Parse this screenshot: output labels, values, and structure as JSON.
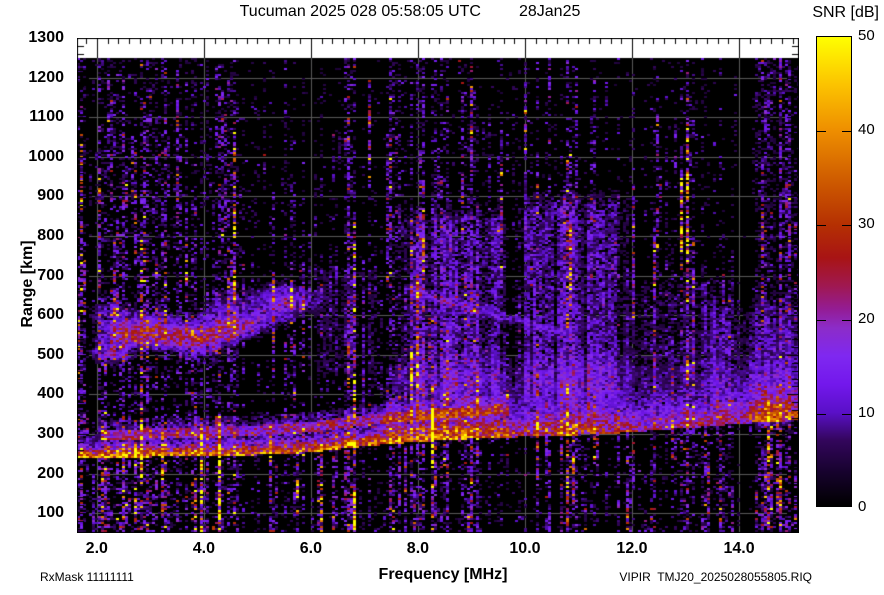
{
  "header": {
    "title": "Tucuman 2025 028 05:58:05 UTC",
    "date": "28Jan25",
    "value_label": "SNR [dB]"
  },
  "footer": {
    "rx_mask": "RxMask 11111111",
    "file_label": "VIPIR  TMJ20_2025028055805.RIQ"
  },
  "chart_data": {
    "type": "heatmap",
    "title": "Tucuman 2025 028 05:58:05 UTC",
    "date_label": "28Jan25",
    "xlabel": "Frequency [MHz]",
    "ylabel": "Range [km]",
    "value_label": "SNR [dB]",
    "xlim": [
      1.63,
      15.12
    ],
    "ylim": [
      50,
      1300
    ],
    "data_top_km": 1250,
    "x_ticks": [
      2,
      4,
      6,
      8,
      10,
      12,
      14
    ],
    "x_tick_labels": [
      "2.0",
      "4.0",
      "6.0",
      "8.0",
      "10.0",
      "12.0",
      "14.0"
    ],
    "x_minor_step": 0.2,
    "y_ticks": [
      100,
      200,
      300,
      400,
      500,
      600,
      700,
      800,
      900,
      1000,
      1100,
      1200,
      1300
    ],
    "y_minor_step": 20,
    "grid": true,
    "grid_color": "#5a5a5a",
    "colorbar": {
      "label": "SNR [dB]",
      "min": 0,
      "max": 50,
      "ticks": [
        0,
        10,
        20,
        30,
        40,
        50
      ],
      "stops": [
        [
          0.0,
          "#000000"
        ],
        [
          0.07,
          "#16022c"
        ],
        [
          0.14,
          "#33065c"
        ],
        [
          0.2,
          "#5a10c8"
        ],
        [
          0.26,
          "#7318ec"
        ],
        [
          0.32,
          "#7f28f0"
        ],
        [
          0.38,
          "#8c2cc8"
        ],
        [
          0.42,
          "#941c94"
        ],
        [
          0.47,
          "#a01850"
        ],
        [
          0.53,
          "#a81414"
        ],
        [
          0.6,
          "#b53002"
        ],
        [
          0.7,
          "#d05e00"
        ],
        [
          0.8,
          "#ee8e00"
        ],
        [
          0.9,
          "#fcc400"
        ],
        [
          1.0,
          "#ffff00"
        ]
      ]
    },
    "noise": {
      "seed": 1337,
      "cell": [
        3,
        2
      ],
      "base_mean_db": 1.7,
      "threshold_db": 4.3,
      "region_mults": [
        [
          1.63,
          1.82,
          3.4
        ],
        [
          1.82,
          4.6,
          1.28
        ],
        [
          4.6,
          6.6,
          0.82
        ],
        [
          6.6,
          9.6,
          0.92
        ],
        [
          9.6,
          12.2,
          0.72
        ],
        [
          12.2,
          15.12,
          0.85
        ]
      ],
      "low_range_boost": {
        "below_km": 350,
        "mult": 1.45
      },
      "rfi_lines": [
        [
          2.1,
          1.6,
          0.06
        ],
        [
          2.5,
          1.2,
          0.05
        ],
        [
          2.9,
          1.4,
          0.06
        ],
        [
          3.25,
          1.2,
          0.05
        ],
        [
          4.25,
          1.1,
          0.05
        ],
        [
          4.6,
          1.4,
          0.06
        ],
        [
          6.2,
          1.3,
          0.05
        ],
        [
          6.78,
          2.6,
          0.05
        ],
        [
          7.5,
          1.1,
          0.05
        ],
        [
          8.1,
          1.3,
          0.06
        ],
        [
          8.55,
          1.5,
          0.07
        ],
        [
          9.0,
          1.4,
          0.06
        ],
        [
          9.55,
          1.2,
          0.05
        ],
        [
          10.4,
          1.3,
          0.05
        ],
        [
          10.9,
          1.7,
          0.06
        ],
        [
          11.3,
          1.3,
          0.05
        ],
        [
          12.4,
          1.1,
          0.05
        ],
        [
          13.1,
          1.4,
          0.05
        ],
        [
          14.35,
          1.5,
          0.06
        ],
        [
          14.9,
          1.7,
          0.08
        ]
      ],
      "dark_bands": [
        [
          5.0,
          5.55,
          0.7
        ],
        [
          9.82,
          10.08,
          0.8
        ],
        [
          13.92,
          14.22,
          0.4
        ]
      ]
    },
    "features": {
      "main_trace": {
        "bottom_edge": [
          [
            1.63,
            243
          ],
          [
            3,
            247
          ],
          [
            5,
            252
          ],
          [
            6,
            258
          ],
          [
            6.6,
            268
          ],
          [
            7.5,
            280
          ],
          [
            8.5,
            290
          ],
          [
            9.5,
            296
          ],
          [
            10.5,
            300
          ],
          [
            11.5,
            305
          ],
          [
            12.5,
            315
          ],
          [
            13.5,
            325
          ],
          [
            14.2,
            333
          ],
          [
            15.12,
            340
          ]
        ],
        "thickness": [
          [
            1.63,
            16
          ],
          [
            6,
            20
          ],
          [
            8,
            34
          ],
          [
            10,
            42
          ],
          [
            12,
            50
          ],
          [
            15.12,
            55
          ]
        ],
        "amp": [
          [
            1.63,
            41
          ],
          [
            5,
            40
          ],
          [
            6.5,
            38
          ],
          [
            7.5,
            39
          ],
          [
            9.3,
            37
          ],
          [
            9.8,
            27
          ],
          [
            10.8,
            29
          ],
          [
            11.8,
            26
          ],
          [
            12.8,
            23
          ],
          [
            13.6,
            22
          ],
          [
            14.1,
            24
          ],
          [
            14.5,
            33
          ],
          [
            15.12,
            30
          ]
        ],
        "fade": [
          [
            1.63,
            18
          ],
          [
            7,
            30
          ],
          [
            10,
            60
          ],
          [
            15.12,
            70
          ]
        ]
      },
      "second_trace": {
        "f_range": [
          2.1,
          9.7
        ],
        "offset": [
          [
            2,
            42
          ],
          [
            6,
            50
          ],
          [
            9.7,
            56
          ]
        ],
        "thickness": 22,
        "amp": 16
      },
      "multihop_blobs": [
        [
          2.25,
          510,
          13
        ],
        [
          2.6,
          545,
          12
        ],
        [
          2.95,
          555,
          11
        ],
        [
          3.3,
          540,
          12
        ],
        [
          3.7,
          556,
          12
        ],
        [
          4.05,
          545,
          11
        ],
        [
          4.45,
          562,
          12
        ],
        [
          4.8,
          575,
          11
        ],
        [
          5.15,
          600,
          10
        ],
        [
          5.5,
          625,
          10
        ],
        [
          5.75,
          640,
          9
        ],
        [
          3.1,
          585,
          9
        ],
        [
          4.2,
          598,
          9
        ],
        [
          2.45,
          570,
          9
        ],
        [
          3.9,
          520,
          10
        ],
        [
          2.2,
          605,
          7
        ],
        [
          4.6,
          640,
          8
        ],
        [
          5.3,
          660,
          7
        ]
      ],
      "spread_regions": [
        [
          7.85,
          9.45,
          430,
          830,
          9
        ],
        [
          10.05,
          11.7,
          430,
          870,
          8.5
        ],
        [
          6.25,
          7.05,
          470,
          700,
          5
        ],
        [
          12.15,
          13.55,
          440,
          660,
          4.5
        ],
        [
          7.5,
          9.5,
          330,
          450,
          6
        ],
        [
          10.0,
          11.7,
          340,
          460,
          5
        ],
        [
          13.6,
          15.12,
          345,
          600,
          5
        ],
        [
          14.5,
          15.12,
          350,
          1250,
          2.5
        ]
      ],
      "descending_trace": {
        "points": [
          [
            7.8,
            665
          ],
          [
            10.9,
            548
          ]
        ],
        "amp": 7,
        "sigma_km": 9
      }
    }
  }
}
